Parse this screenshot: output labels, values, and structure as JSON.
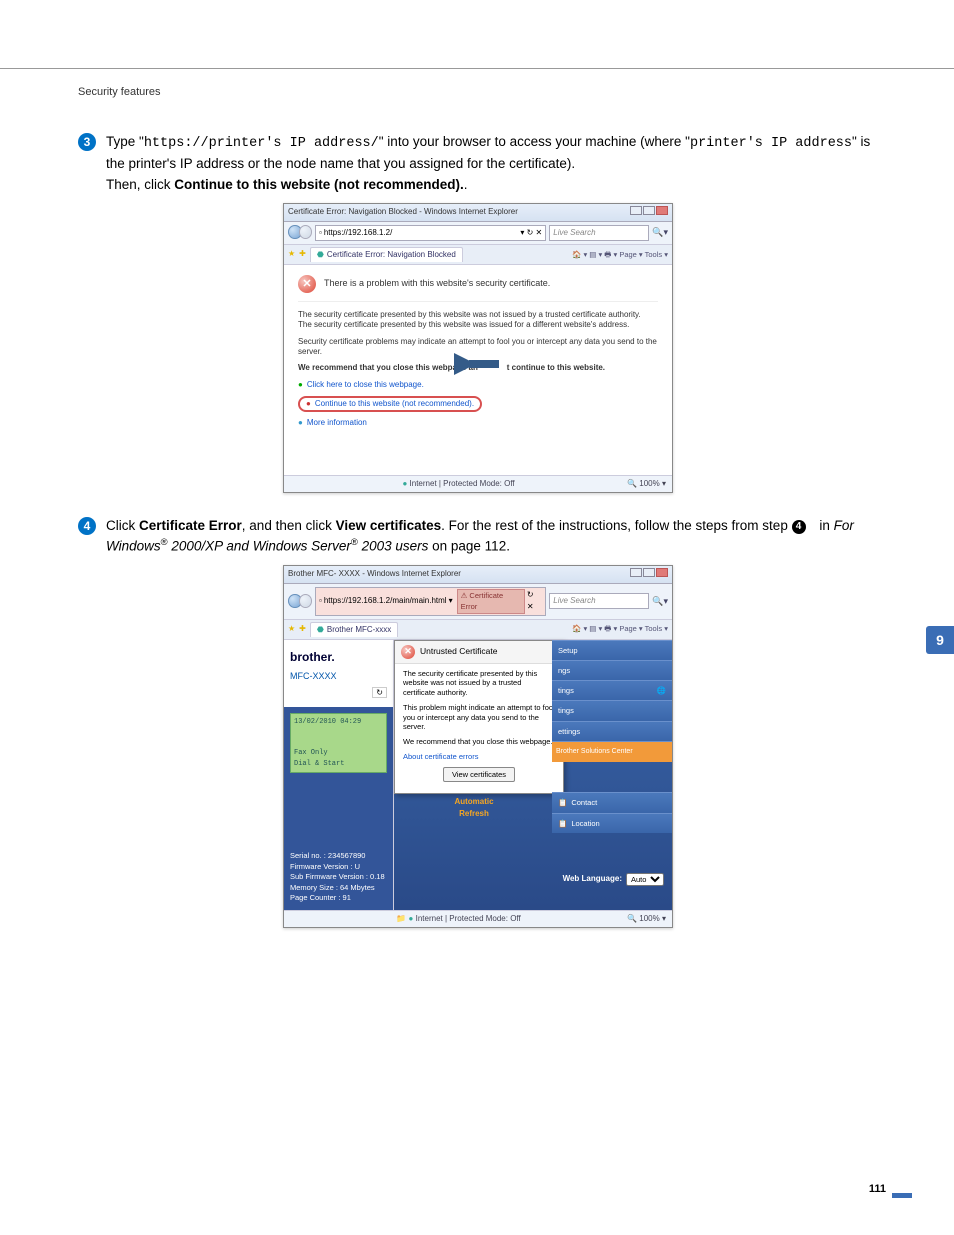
{
  "header": {
    "section": "Security features"
  },
  "step3": {
    "num": "3",
    "pre": "Type \"",
    "url": "https://printer's IP address/",
    "mid": "\" into your browser to access your machine (where \"",
    "addr": "printer's IP address",
    "post": "\" is the printer's IP address or the node name that you assigned for the certificate).",
    "then_pre": "Then, click ",
    "then_bold": "Continue to this website (not recommended).",
    "then_post": "."
  },
  "ie1": {
    "title_left": "Certificate Error: Navigation Blocked - Windows Internet Explorer",
    "address": "https://192.168.1.2/",
    "search_placeholder": "Live Search",
    "tab": "Certificate Error: Navigation Blocked",
    "toolbar": "Page ▾  Tools ▾",
    "cert_heading": "There is a problem with this website's security certificate.",
    "cert_p1": "The security certificate presented by this website was not issued by a trusted certificate authority.\nThe security certificate presented by this website was issued for a different website's address.",
    "cert_p2": "Security certificate problems may indicate an attempt to fool you or intercept any data you send to the server.",
    "cert_rec_pre": "We recommend that you close this webpage an",
    "cert_rec_post": "t continue to this website.",
    "close_link": "Click here to close this webpage.",
    "continue_link": "Continue to this website (not recommended).",
    "more_info": "More information",
    "status": "Internet | Protected Mode: Off",
    "zoom": "100%"
  },
  "step4": {
    "num": "4",
    "pre": "Click ",
    "b1": "Certificate Error",
    "mid": ", and then click ",
    "b2": "View certificates",
    "post1": ". For the rest of the instructions, follow the steps from step ",
    "inline_num": "4",
    "post2": " in ",
    "italic": "For Windows",
    "reg1": "®",
    "italic2": " 2000/XP and Windows Server",
    "reg2": "®",
    "italic3": " 2003 users",
    "post3": " on page 112."
  },
  "ie2": {
    "title_left": "Brother MFC- XXXX  - Windows Internet Explorer",
    "address": "https://192.168.1.2/main/main.html",
    "cert_err": "Certificate Error",
    "search_placeholder": "Live Search",
    "tab": "Brother MFC-xxxx",
    "toolbar": "Page ▾  Tools ▾",
    "brand": "brother.",
    "model": "MFC-XXXX",
    "lcd_time": "13/02/2010 04:29",
    "lcd_l1": "Fax Only",
    "lcd_l2": "Dial & Start",
    "info_serial": "Serial no. : 234567890",
    "info_fw": "Firmware Version : U",
    "info_subfw": "Sub Firmware Version : 0.18",
    "info_mem": "Memory Size : 64 Mbytes",
    "info_pc": "Page Counter : 91",
    "popup_title": "Untrusted Certificate",
    "popup_p1": "The security certificate presented by this website was not issued by a trusted certificate authority.",
    "popup_p2": "This problem might indicate an attempt to fool you or intercept any data you send to the server.",
    "popup_p3": "We recommend that you close this webpage.",
    "popup_link": "About certificate errors",
    "popup_btn": "View certificates",
    "menu": {
      "setup": "Setup",
      "ngs1": "ngs",
      "tings1": "tings",
      "tings2": "tings",
      "ettings": "ettings",
      "center": "Brother Solutions Center",
      "contact": "Contact",
      "location": "Location"
    },
    "auto_refresh": "Automatic\nRefresh",
    "web_lang_label": "Web Language:",
    "web_lang_value": "Auto",
    "status": "Internet | Protected Mode: Off",
    "zoom": "100%"
  },
  "sidetab": "9",
  "page_number": "111"
}
